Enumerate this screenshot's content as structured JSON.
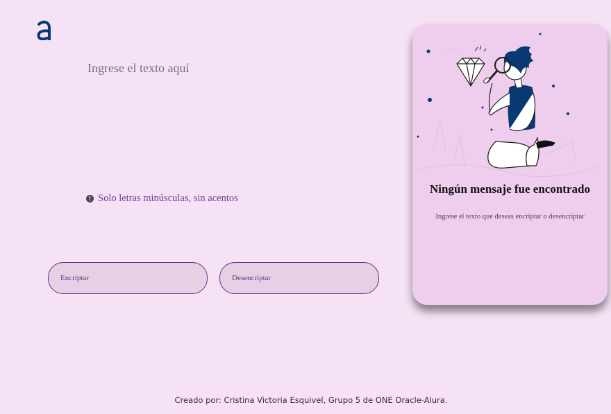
{
  "input": {
    "placeholder": "Ingrese el texto aquí"
  },
  "hint": {
    "icon": "info-exclamation-icon",
    "text": "Solo letras minúsculas, sin acentos"
  },
  "buttons": {
    "encrypt_label": "Encriptar",
    "decrypt_label": "Desencriptar"
  },
  "result_panel": {
    "title": "Ningún mensaje fue encontrado",
    "text": "Ingrese el texto que deseas encriptar o desencriptar"
  },
  "footer": {
    "text": "Creado por: Cristina Victoria Esquivel, Grupo 5 de ONE Oracle-Alura."
  },
  "colors": {
    "background": "#f5e3f5",
    "accent": "#6d2c82",
    "brand_blue": "#0a3871",
    "panel": "#efceed"
  }
}
